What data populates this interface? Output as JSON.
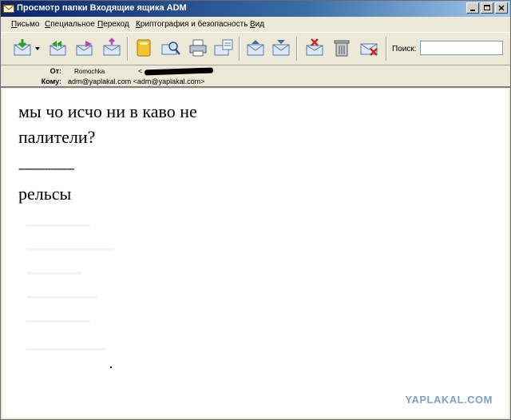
{
  "window": {
    "title": "Просмотр папки Входящие ящика ADM",
    "controls": [
      "minimize",
      "maximize",
      "close"
    ]
  },
  "menu": {
    "items": [
      {
        "label": "Письмо",
        "accel": "П"
      },
      {
        "label": "Специальное",
        "accel": "С"
      },
      {
        "label": "Переход",
        "accel": "П"
      },
      {
        "label": "Криптография и безопасность",
        "accel": "К"
      },
      {
        "label": "Вид",
        "accel": "В"
      }
    ]
  },
  "toolbar": {
    "buttons": [
      "receive-mail-icon",
      "dropdown-arrow-icon",
      "reply-all-icon",
      "forward-icon",
      "new-mail-icon",
      "address-book-icon",
      "find-icon",
      "print-icon",
      "properties-icon",
      "prev-message-icon",
      "next-message-icon",
      "delete-message-icon",
      "trash-icon",
      "cancel-message-icon"
    ],
    "search_label": "Поиск:",
    "search_value": ""
  },
  "headers": {
    "from_label": "От:",
    "from_name": "Romochka",
    "from_addr_prefix": "<",
    "to_label": "Кому:",
    "to_value": "adm@yaplakal.com <adm@yaplakal.com>"
  },
  "message": {
    "line1": "мы чо исчо ни в каво не",
    "line2": "палители?",
    "separator": "-------------------",
    "line3": "рельсы"
  },
  "watermark": "YAPLAKAL.COM",
  "colors": {
    "titlebar_start": "#0a246a",
    "titlebar_end": "#a6caf0",
    "chrome": "#ece9d8",
    "watermark": "#7aa3c8"
  }
}
